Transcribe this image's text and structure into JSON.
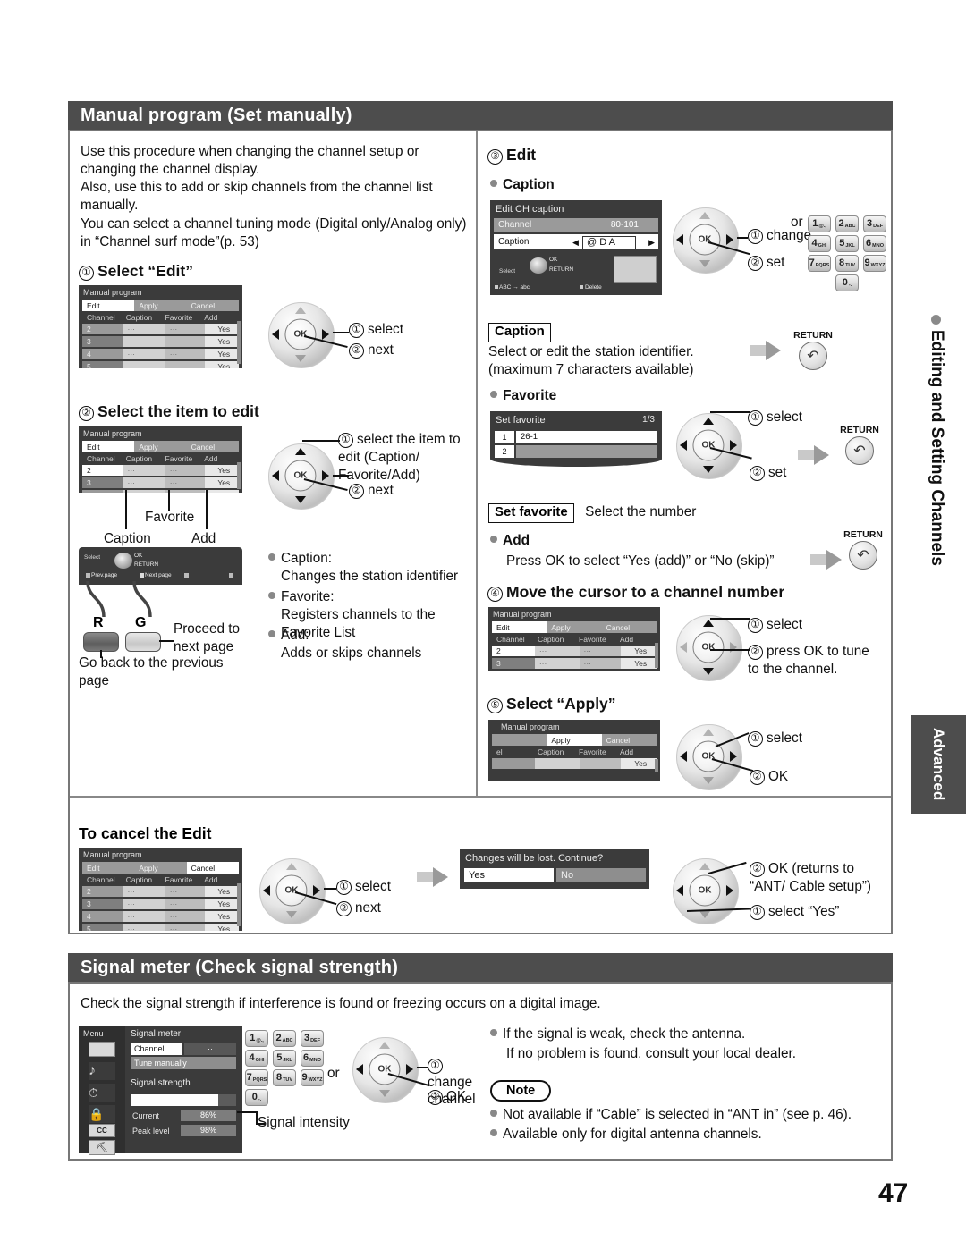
{
  "page": {
    "number": "47"
  },
  "section1": {
    "title": "Manual program (Set manually)",
    "intro": [
      "Use this procedure when changing the channel setup or changing the channel display.",
      "Also, use this to add or skip channels from the channel list manually.",
      "You can select a channel tuning mode (Digital only/Analog only) in “Channel surf mode”(p. 53)"
    ],
    "step1": {
      "num": "①",
      "title": "Select “Edit”",
      "callouts": [
        {
          "num": "①",
          "text": "select"
        },
        {
          "num": "②",
          "text": "next"
        }
      ]
    },
    "step2": {
      "num": "②",
      "title": "Select the item to edit",
      "callouts": [
        {
          "num": "①",
          "text": "select the item to edit (Caption/ Favorite/Add)"
        },
        {
          "num": "②",
          "text": "next"
        }
      ],
      "labels": {
        "caption": "Caption",
        "favorite": "Favorite",
        "add": "Add"
      },
      "osd_footer": {
        "select": "Select",
        "ok": "OK",
        "return": "RETURN",
        "prev_page": "Prev.page",
        "next_page": "Next page"
      },
      "remote": {
        "red_label": "R",
        "green_label": "G",
        "green_text": "Proceed to next page",
        "red_text": "Go back to the previous page"
      },
      "bullets": [
        {
          "term": "Caption:",
          "desc": "Changes the station identifier"
        },
        {
          "term": "Favorite:",
          "desc": "Registers channels to the Favorite List"
        },
        {
          "term": "Add:",
          "desc": "Adds or skips channels"
        }
      ]
    },
    "step3": {
      "num": "③",
      "title": "Edit",
      "caption_heading": "Caption",
      "osd": {
        "title": "Edit CH caption",
        "channel_label": "Channel",
        "channel_value": "80-101",
        "caption_label": "Caption",
        "caption_value": "@ D A",
        "select": "Select",
        "ok": "OK",
        "return": "RETURN",
        "abc_hint": "ABC → abc",
        "delete_hint": "Delete"
      },
      "callouts": [
        {
          "num": "①",
          "text": "change"
        },
        {
          "num": "②",
          "text": "set"
        }
      ],
      "or_label": "or",
      "keypad": [
        {
          "digit": "1",
          "sub": "@.,"
        },
        {
          "digit": "2",
          "sub": "ABC"
        },
        {
          "digit": "3",
          "sub": "DEF"
        },
        {
          "digit": "4",
          "sub": "GHI"
        },
        {
          "digit": "5",
          "sub": "JKL"
        },
        {
          "digit": "6",
          "sub": "MNO"
        },
        {
          "digit": "7",
          "sub": "PQRS"
        },
        {
          "digit": "8",
          "sub": "TUV"
        },
        {
          "digit": "9",
          "sub": "WXYZ"
        },
        {
          "digit": "0",
          "sub": "-."
        }
      ],
      "caption_note_label": "Caption",
      "caption_note_lines": [
        "Select or edit the station identifier.",
        "(maximum 7 characters available)"
      ],
      "return_label": "RETURN",
      "favorite_heading": "Favorite",
      "favorite_osd": {
        "title": "Set favorite",
        "page": "1/3",
        "rows": [
          {
            "num": "1",
            "value": "26-1"
          },
          {
            "num": "2",
            "value": ""
          }
        ]
      },
      "favorite_callouts": [
        {
          "num": "①",
          "text": "select"
        },
        {
          "num": "②",
          "text": "set"
        }
      ],
      "setfav_label": "Set favorite",
      "setfav_text": "Select the number",
      "add_heading": "Add",
      "add_text": "Press OK to select “Yes (add)” or “No (skip)”"
    },
    "step4": {
      "num": "④",
      "title": "Move the cursor to a channel number",
      "callouts": [
        {
          "num": "①",
          "text": "select"
        },
        {
          "num": "②",
          "text": "press OK to tune to the channel."
        }
      ]
    },
    "step5": {
      "num": "⑤",
      "title": "Select “Apply”",
      "callouts": [
        {
          "num": "①",
          "text": "select"
        },
        {
          "num": "②",
          "text": "OK"
        }
      ]
    },
    "cancel": {
      "title": "To cancel the Edit",
      "callouts": [
        {
          "num": "①",
          "text": "select"
        },
        {
          "num": "②",
          "text": "next"
        }
      ],
      "dialog": {
        "message": "Changes will be lost. Continue?",
        "yes": "Yes",
        "no": "No"
      },
      "callouts2": [
        {
          "num": "②",
          "text": "OK (returns to “ANT/ Cable setup”)"
        },
        {
          "num": "①",
          "text": "select “Yes”"
        }
      ]
    },
    "osd_table": {
      "title": "Manual program",
      "tabs": [
        "Edit",
        "Apply",
        "Cancel"
      ],
      "headers": [
        "Channel",
        "Caption",
        "Favorite",
        "Add"
      ],
      "rows": [
        {
          "channel": "2",
          "caption": "···",
          "favorite": "···",
          "add": "Yes"
        },
        {
          "channel": "3",
          "caption": "···",
          "favorite": "···",
          "add": "Yes"
        },
        {
          "channel": "4",
          "caption": "···",
          "favorite": "···",
          "add": "Yes"
        },
        {
          "channel": "5",
          "caption": "···",
          "favorite": "···",
          "add": "Yes"
        }
      ]
    }
  },
  "section2": {
    "title": "Signal meter (Check signal strength)",
    "intro": "Check the signal strength if interference is found or freezing occurs on a digital image.",
    "osd": {
      "menu_label": "Menu",
      "title": "Signal meter",
      "channel_label": "Channel",
      "channel_value": "··",
      "tune_label": "Tune manually",
      "strength_label": "Signal strength",
      "current_label": "Current",
      "current_value": "86%",
      "peak_label": "Peak level",
      "peak_value": "98%",
      "icons": [
        "picture-icon",
        "audio-icon",
        "timer-icon",
        "lock-icon",
        "cc-icon",
        "setup-icon"
      ]
    },
    "intensity_label": "Signal intensity",
    "or_label": "or",
    "callouts": [
      {
        "num": "①",
        "text": "change channel"
      },
      {
        "num": "②",
        "text": "OK"
      }
    ],
    "keypad": [
      {
        "digit": "1",
        "sub": "@.,"
      },
      {
        "digit": "2",
        "sub": "ABC"
      },
      {
        "digit": "3",
        "sub": "DEF"
      },
      {
        "digit": "4",
        "sub": "GHI"
      },
      {
        "digit": "5",
        "sub": "JKL"
      },
      {
        "digit": "6",
        "sub": "MNO"
      },
      {
        "digit": "7",
        "sub": "PQRS"
      },
      {
        "digit": "8",
        "sub": "TUV"
      },
      {
        "digit": "9",
        "sub": "WXYZ"
      },
      {
        "digit": "0",
        "sub": "-."
      }
    ],
    "tips": [
      "If the signal is weak, check the antenna.",
      "If no problem is found, consult your local dealer."
    ],
    "note_label": "Note",
    "notes": [
      "Not available if “Cable” is selected in “ANT in” (see p. 46).",
      "Available only for digital antenna channels."
    ]
  },
  "index_tab": {
    "chapter": "Editing and Setting Channels",
    "level": "Advanced"
  }
}
